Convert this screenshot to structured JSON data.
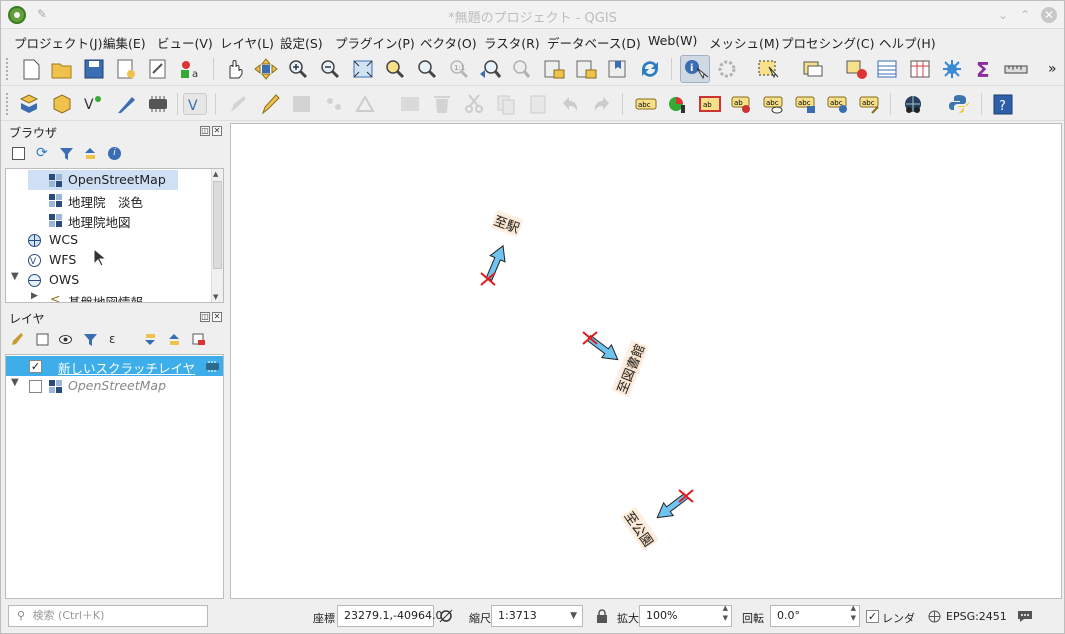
{
  "window": {
    "title": "*無題のプロジェクト - QGIS"
  },
  "menu": [
    "プロジェクト(J)",
    "編集(E)",
    "ビュー(V)",
    "レイヤ(L)",
    "設定(S)",
    "プラグイン(P)",
    "ベクタ(O)",
    "ラスタ(R)",
    "データベース(D)",
    "Web(W)",
    "メッシュ(M)",
    "プロセシング(C)",
    "ヘルプ(H)"
  ],
  "toolbar_overflow": "»",
  "browser": {
    "title": "ブラウザ",
    "items": [
      "OpenStreetMap",
      "地理院　淡色",
      "地理院地図",
      "WCS",
      "WFS",
      "OWS",
      "基盤地図情報"
    ]
  },
  "layers": {
    "title": "レイヤ",
    "items": [
      "新しいスクラッチレイヤ",
      "OpenStreetMap"
    ]
  },
  "map": {
    "labels": [
      "至駅",
      "至図書館",
      "至公園"
    ],
    "arrow_color": "#6ec3f0",
    "marker_color": "#e01b1b"
  },
  "status": {
    "search_placeholder": "検索 (Ctrl＋K)",
    "coord_label": "座標",
    "coord_value": "23279.1,-40964.0",
    "scale_label": "縮尺",
    "scale_value": "1:3713",
    "magnifier_label": "拡大",
    "magnifier_value": "100%",
    "rotation_label": "回転",
    "rotation_value": "0.0°",
    "render_label": "レンダ",
    "crs": "EPSG:2451"
  }
}
